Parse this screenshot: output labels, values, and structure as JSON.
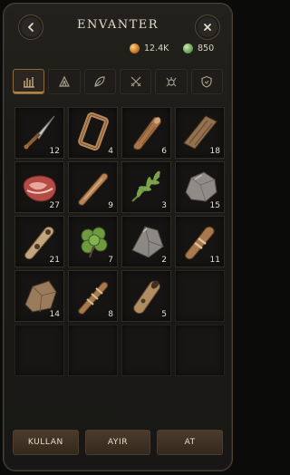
{
  "header": {
    "title": "ENVANTER",
    "back_icon": "arrow-left-icon",
    "close_icon": "close-icon"
  },
  "currency": {
    "gold": {
      "value": "12.4K",
      "icon": "gold-coin-icon",
      "color": "#d68a2a"
    },
    "gem": {
      "value": "850",
      "icon": "green-gem-icon",
      "color": "#6ea25a"
    }
  },
  "tabs": [
    {
      "icon": "all-items-icon",
      "active": true
    },
    {
      "icon": "camp-tent-icon",
      "active": false
    },
    {
      "icon": "leaf-icon",
      "active": false
    },
    {
      "icon": "crossed-swords-icon",
      "active": false
    },
    {
      "icon": "creature-icon",
      "active": false
    },
    {
      "icon": "shield-icon",
      "active": false
    }
  ],
  "items": [
    {
      "icon": "bone-dagger-icon",
      "qty": "12"
    },
    {
      "icon": "wooden-frame-icon",
      "qty": "4"
    },
    {
      "icon": "wood-log-icon",
      "qty": "6"
    },
    {
      "icon": "wood-plank-icon",
      "qty": "18"
    },
    {
      "icon": "raw-meat-icon",
      "qty": "27"
    },
    {
      "icon": "wood-stick-icon",
      "qty": "9"
    },
    {
      "icon": "herb-sprig-icon",
      "qty": "3"
    },
    {
      "icon": "stone-icon",
      "qty": "15"
    },
    {
      "icon": "carved-bone-icon",
      "qty": "21"
    },
    {
      "icon": "green-herb-icon",
      "qty": "7"
    },
    {
      "icon": "flint-icon",
      "qty": "2"
    },
    {
      "icon": "bound-wood-icon",
      "qty": "11"
    },
    {
      "icon": "wood-chunk-icon",
      "qty": "14"
    },
    {
      "icon": "tied-bundle-icon",
      "qty": "8"
    },
    {
      "icon": "hollow-log-icon",
      "qty": "5"
    }
  ],
  "empty_slots": 5,
  "actions": {
    "use_label": "KULLAN",
    "split_label": "AYIR",
    "drop_label": "AT"
  },
  "colors": {
    "accent": "#b08345",
    "panel_bg": "#1b1a17",
    "text": "#e4dccb"
  }
}
